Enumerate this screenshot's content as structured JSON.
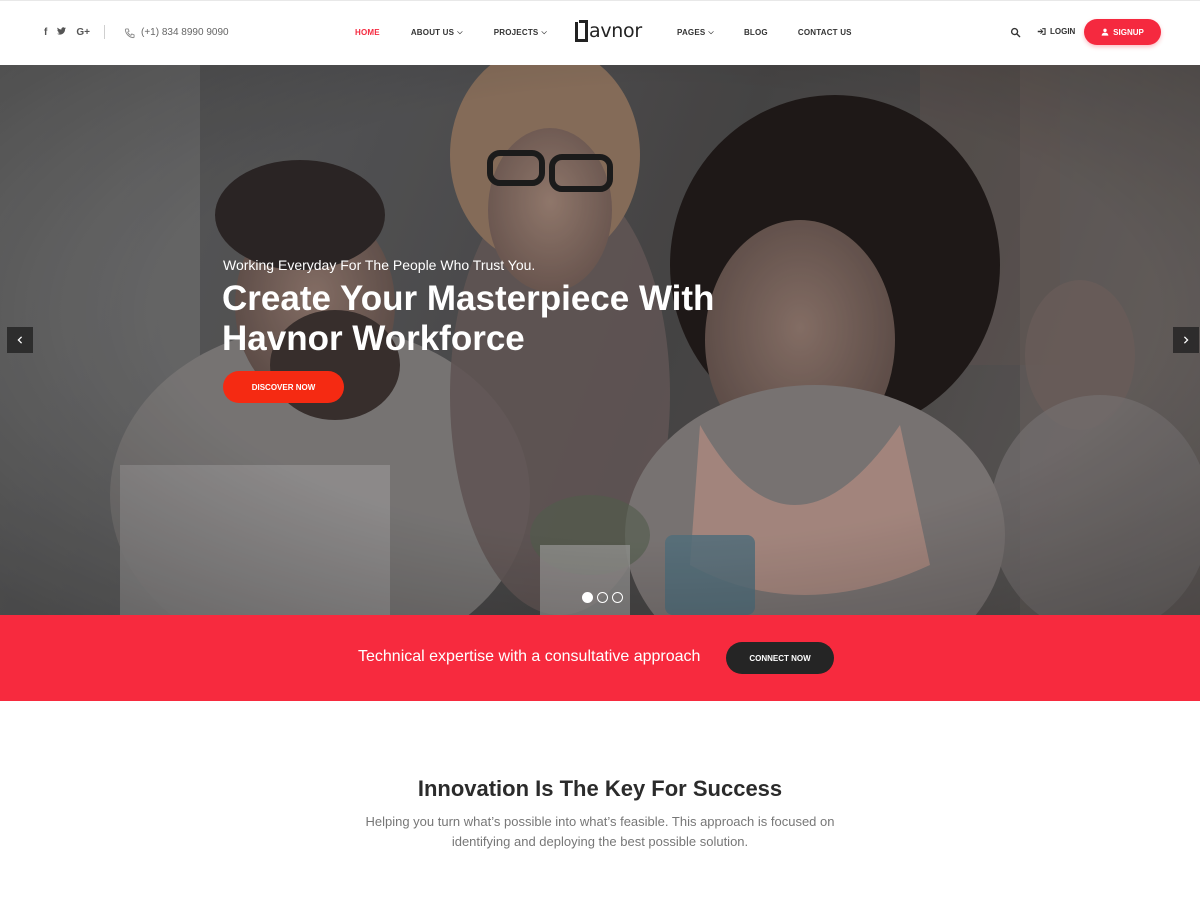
{
  "header": {
    "social": [
      {
        "icon": "facebook-icon",
        "glyph": "f"
      },
      {
        "icon": "twitter-icon",
        "glyph": "🐦"
      },
      {
        "icon": "google-plus-icon",
        "glyph": "G+"
      }
    ],
    "phone": "(+1) 834 8990 9090",
    "nav_left": [
      {
        "label": "HOME",
        "active": true,
        "dropdown": false
      },
      {
        "label": "ABOUT US",
        "dropdown": true
      },
      {
        "label": "PROJECTS",
        "dropdown": true
      }
    ],
    "logo_text": "avnor",
    "nav_right": [
      {
        "label": "PAGES",
        "dropdown": true
      },
      {
        "label": "BLOG",
        "dropdown": false
      },
      {
        "label": "CONTACT US",
        "dropdown": false
      }
    ],
    "login_label": "LOGIN",
    "signup_label": "SIGNUP",
    "chevron": "⌄"
  },
  "hero": {
    "subtitle": "Working Everyday For The People Who Trust You.",
    "title": "Create Your Masterpiece With Havnor Workforce",
    "button": "DISCOVER NOW",
    "slides": 3,
    "active_slide": 1
  },
  "band": {
    "text": "Technical expertise with a consultative approach",
    "button": "CONNECT NOW"
  },
  "intro": {
    "title": "Innovation Is The Key For Success",
    "text": "Helping you turn what’s possible into what’s feasible. This approach is focused on identifying and deploying the best possible solution."
  },
  "colors": {
    "accent": "#f5293f",
    "hero_button": "#f52a12",
    "dark_button": "#252525"
  }
}
